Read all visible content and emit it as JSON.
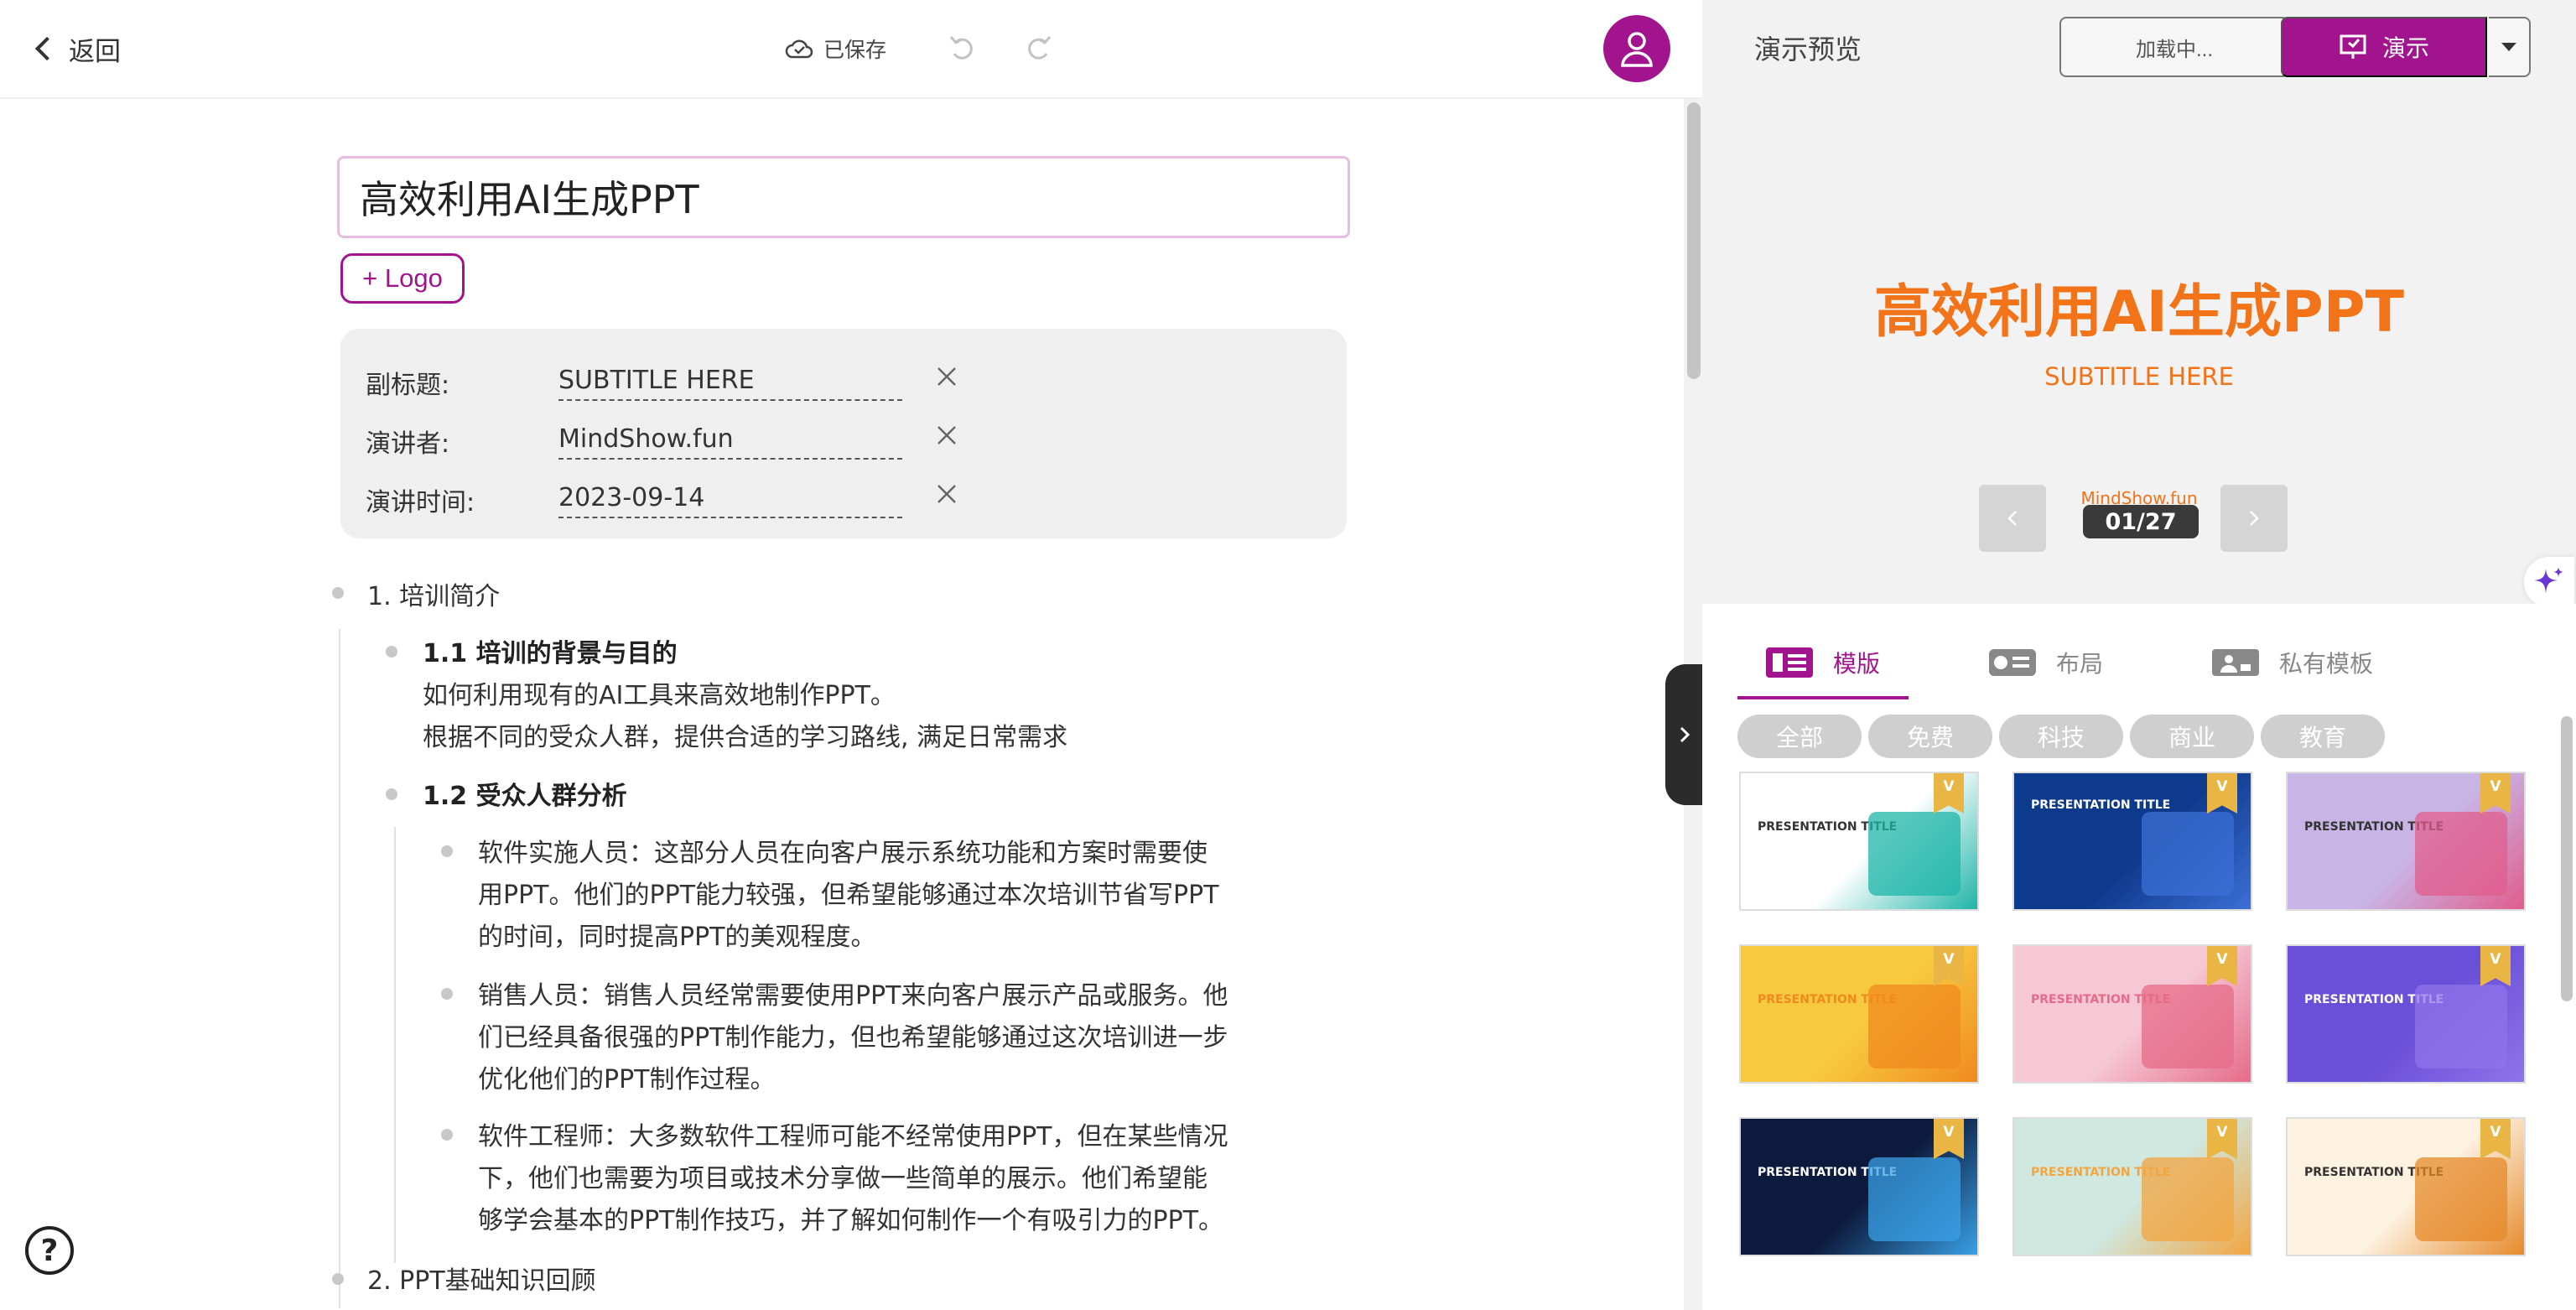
{
  "topbar": {
    "back_label": "返回",
    "saved_label": "已保存"
  },
  "editor": {
    "title_value": "高效利用AI生成PPT",
    "logo_button": "+ Logo",
    "meta": [
      {
        "label": "副标题:",
        "value": "SUBTITLE HERE"
      },
      {
        "label": "演讲者:",
        "value": "MindShow.fun"
      },
      {
        "label": "演讲时间:",
        "value": "2023-09-14"
      }
    ],
    "outline": {
      "s1": "1. 培训简介",
      "s1_1": "1.1 培训的背景与目的",
      "s1_1_l1": "如何利用现有的AI工具来高效地制作PPT。",
      "s1_1_l2": "根据不同的受众人群，提供合适的学习路线, 满足日常需求",
      "s1_2": "1.2 受众人群分析",
      "b1_l1": "软件实施人员：这部分人员在向客户展示系统功能和方案时需要使",
      "b1_l2": "用PPT。他们的PPT能力较强，但希望能够通过本次培训节省写PPT",
      "b1_l3": "的时间，同时提高PPT的美观程度。",
      "b2_l1": "销售人员：销售人员经常需要使用PPT来向客户展示产品或服务。他",
      "b2_l2": "们已经具备很强的PPT制作能力，但也希望能够通过这次培训进一步",
      "b2_l3": "优化他们的PPT制作过程。",
      "b3_l1": "软件工程师：大多数软件工程师可能不经常使用PPT，但在某些情况",
      "b3_l2": "下，他们也需要为项目或技术分享做一些简单的展示。他们希望能",
      "b3_l3": "够学会基本的PPT制作技巧，并了解如何制作一个有吸引力的PPT。",
      "s2": "2. PPT基础知识回顾"
    },
    "help_label": "?"
  },
  "preview": {
    "title": "演示预览",
    "loading_label": "加载中...",
    "present_label": "演示",
    "slide_title": "高效利用AI生成PPT",
    "slide_subtitle": "SUBTITLE HERE",
    "slide_author": "MindShow.fun",
    "page_indicator": "01/27"
  },
  "templates": {
    "tabs": [
      "模版",
      "布局",
      "私有模板"
    ],
    "chips": [
      "全部",
      "免费",
      "科技",
      "商业",
      "教育"
    ],
    "badge": "V",
    "thumbs": [
      {
        "title": "PRESENTATION TITLE",
        "bg": "#ffffff",
        "accent": "#1fb5a8"
      },
      {
        "title": "PRESENTATION TITLE",
        "bg": "#0e3a8c",
        "accent": "#3c6fd6"
      },
      {
        "title": "PRESENTATION TITLE",
        "bg": "#c9b4e6",
        "accent": "#e05d8c"
      },
      {
        "title": "PRESENTATION TITLE",
        "bg": "#f7c93e",
        "accent": "#f08a1e"
      },
      {
        "title": "PRESENTATION TITLE",
        "bg": "#f6c7d4",
        "accent": "#e56b8a"
      },
      {
        "title": "PRESENTATION TITLE",
        "bg": "#6a4fd8",
        "accent": "#8d74ea"
      },
      {
        "title": "PRESENTATION TITLE",
        "bg": "#0c1b3d",
        "accent": "#3aa0e6"
      },
      {
        "title": "PRESENTATION TITLE",
        "bg": "#cfe8e0",
        "accent": "#f2a541"
      },
      {
        "title": "PRESENTATION TITLE",
        "bg": "#fdf1df",
        "accent": "#e58a2a"
      }
    ]
  },
  "colors": {
    "brand": "#a2148e",
    "slide_accent": "#f27318"
  }
}
